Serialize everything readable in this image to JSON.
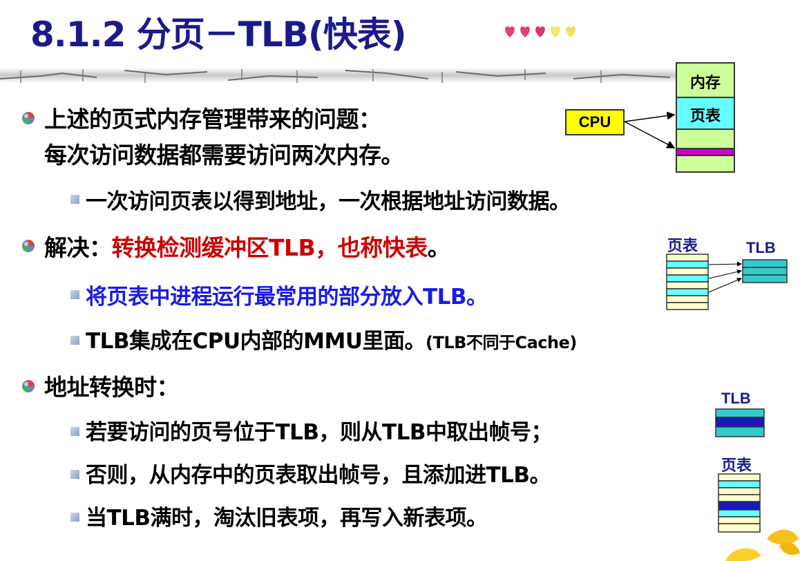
{
  "title": "8.1.2 分页－TLB(快表)",
  "bullets": {
    "b1_line1": "上述的页式内存管理带来的问题：",
    "b1_line2": "每次访问数据都需要访问两次内存。",
    "b1_sub1": "一次访问页表以得到地址，一次根据地址访问数据。",
    "b2_label": "解决：",
    "b2_highlight": "转换检测缓冲区TLB，也称快表",
    "b2_end": "。",
    "b2_sub1": "将页表中进程运行最常用的部分放入TLB。",
    "b2_sub2": "TLB集成在CPU内部的MMU里面。",
    "b2_sub2_note": "(TLB不同于Cache)",
    "b3_label": "地址转换时：",
    "b3_sub1": "若要访问的页号位于TLB，则从TLB中取出帧号；",
    "b3_sub2": "否则，从内存中的页表取出帧号，且添加进TLB。",
    "b3_sub3": "当TLB满时，淘汰旧表项，再写入新表项。"
  },
  "diagram1": {
    "cpu_label": "CPU",
    "memory_label": "内存",
    "page_table_label": "页表"
  },
  "diagram2": {
    "page_table_label": "页表",
    "tlb_label": "TLB"
  },
  "diagram3": {
    "tlb_label": "TLB",
    "page_table_label": "页表"
  },
  "colors": {
    "title": "#1a1a8c",
    "highlight_red": "#cc0000",
    "highlight_blue": "#1a1ae6",
    "cell_green": "#ccff99",
    "cell_cyan": "#66ffff",
    "cell_yellow": "#ffffcc",
    "cell_magenta": "#cc00cc",
    "tlb_cyan": "#33cccc",
    "tlb_dark_blue": "#1a1ab8",
    "cpu_yellow": "#ffff00"
  }
}
